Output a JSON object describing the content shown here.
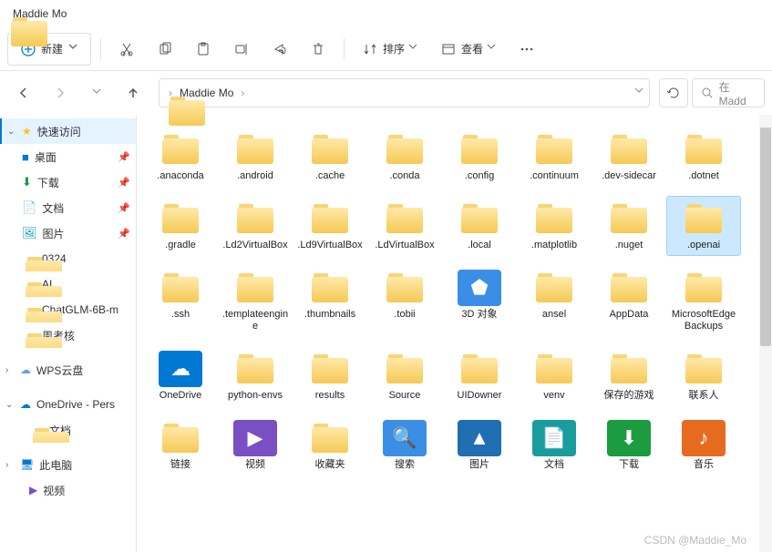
{
  "window": {
    "title": "Maddie Mo"
  },
  "toolbar": {
    "new": "新建",
    "sort": "排序",
    "view": "查看"
  },
  "breadcrumb": {
    "segs": [
      "Maddie Mo"
    ]
  },
  "search": {
    "placeholder": "在 Madd"
  },
  "sidebar": {
    "quick": {
      "label": "快速访问",
      "expanded": true
    },
    "items": [
      {
        "label": "桌面",
        "icon": "desktop",
        "pin": true,
        "color": "#0078d4"
      },
      {
        "label": "下载",
        "icon": "download",
        "pin": true,
        "color": "#1a9c3f"
      },
      {
        "label": "文档",
        "icon": "document",
        "pin": true,
        "color": "#5b6fb8"
      },
      {
        "label": "图片",
        "icon": "picture",
        "pin": true,
        "color": "#0099bc"
      },
      {
        "label": "0324",
        "icon": "folder",
        "pin": false
      },
      {
        "label": "AI",
        "icon": "folder",
        "pin": false
      },
      {
        "label": "ChatGLM-6B-m",
        "icon": "folder",
        "pin": false
      },
      {
        "label": "周考核",
        "icon": "folder",
        "pin": false
      }
    ],
    "wps": {
      "label": "WPS云盘",
      "expanded": false
    },
    "onedrive": {
      "label": "OneDrive - Pers",
      "expanded": true,
      "child": "文档"
    },
    "thispc": {
      "label": "此电脑",
      "expanded": false
    },
    "videos": {
      "label": "视频"
    }
  },
  "files": [
    {
      "label": ".anaconda",
      "t": "folder"
    },
    {
      "label": ".android",
      "t": "folder"
    },
    {
      "label": ".cache",
      "t": "folder"
    },
    {
      "label": ".conda",
      "t": "folder"
    },
    {
      "label": ".config",
      "t": "folder"
    },
    {
      "label": ".continuum",
      "t": "folder"
    },
    {
      "label": ".dev-sidecar",
      "t": "folder"
    },
    {
      "label": ".dotnet",
      "t": "folder"
    },
    {
      "label": ".gradle",
      "t": "folder"
    },
    {
      "label": ".Ld2VirtualBox",
      "t": "folder"
    },
    {
      "label": ".Ld9VirtualBox",
      "t": "folder"
    },
    {
      "label": ".LdVirtualBox",
      "t": "folder"
    },
    {
      "label": ".local",
      "t": "folder"
    },
    {
      "label": ".matplotlib",
      "t": "folder"
    },
    {
      "label": ".nuget",
      "t": "folder"
    },
    {
      "label": ".openai",
      "t": "folder",
      "sel": true
    },
    {
      "label": ".ssh",
      "t": "folder"
    },
    {
      "label": ".templateengine",
      "t": "folder"
    },
    {
      "label": ".thumbnails",
      "t": "folder"
    },
    {
      "label": ".tobii",
      "t": "folder"
    },
    {
      "label": "3D 对象",
      "t": "3d"
    },
    {
      "label": "ansel",
      "t": "folder"
    },
    {
      "label": "AppData",
      "t": "folder"
    },
    {
      "label": "MicrosoftEdgeBackups",
      "t": "folder"
    },
    {
      "label": "OneDrive",
      "t": "onedrive"
    },
    {
      "label": "python-envs",
      "t": "folder"
    },
    {
      "label": "results",
      "t": "folder"
    },
    {
      "label": "Source",
      "t": "folder"
    },
    {
      "label": "UIDowner",
      "t": "folder"
    },
    {
      "label": "venv",
      "t": "folder"
    },
    {
      "label": "保存的游戏",
      "t": "folder"
    },
    {
      "label": "联系人",
      "t": "folder"
    },
    {
      "label": "链接",
      "t": "folder"
    },
    {
      "label": "视频",
      "t": "video"
    },
    {
      "label": "收藏夹",
      "t": "folder"
    },
    {
      "label": "搜索",
      "t": "search"
    },
    {
      "label": "图片",
      "t": "picture"
    },
    {
      "label": "文档",
      "t": "document"
    },
    {
      "label": "下载",
      "t": "download"
    },
    {
      "label": "音乐",
      "t": "music"
    }
  ],
  "watermark": "CSDN @Maddie_Mo"
}
